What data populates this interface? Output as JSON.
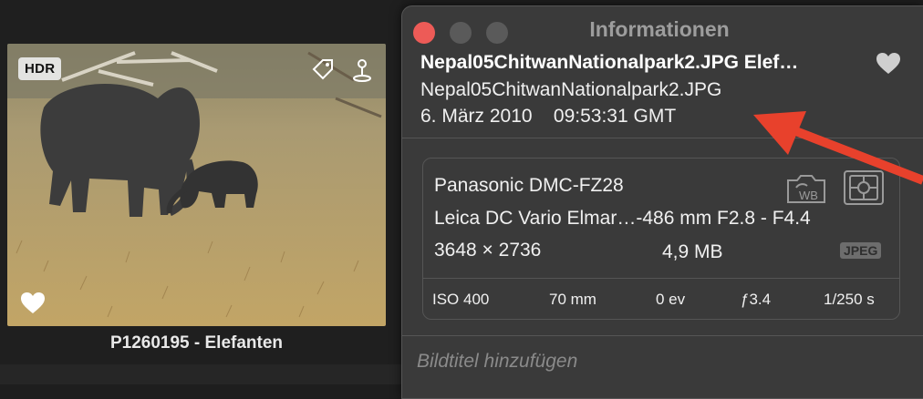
{
  "library": {
    "hdr_badge": "HDR",
    "caption": "P1260195 - Elefanten",
    "icons": [
      "tag-icon",
      "location-pin-icon",
      "heart-icon"
    ]
  },
  "info_panel": {
    "title": "Informationen",
    "file_title": "Nepal05ChitwanNationalpark2.JPG Elef…",
    "file_name": "Nepal05ChitwanNationalpark2.JPG",
    "date": "6. März 2010",
    "time": "09:53:31 GMT",
    "favorite_icon": "heart-icon",
    "exif": {
      "camera_model": "Panasonic DMC-FZ28",
      "lens": "Leica DC Vario Elmar…-486 mm F2.8 - F4.4",
      "dimensions": "3648 × 2736",
      "file_size": "4,9 MB",
      "format_badge": "JPEG",
      "iso": "ISO 400",
      "focal_length": "70 mm",
      "exposure_bias": "0 ev",
      "aperture": "ƒ3.4",
      "shutter_speed": "1/250 s",
      "icons": [
        "white-balance-icon",
        "metering-mode-icon"
      ]
    },
    "caption_placeholder": "Bildtitel hinzufügen"
  },
  "colors": {
    "close_button": "#ed5b57",
    "panel_background": "#3a3a3a",
    "annotation_arrow": "#e8412c"
  }
}
